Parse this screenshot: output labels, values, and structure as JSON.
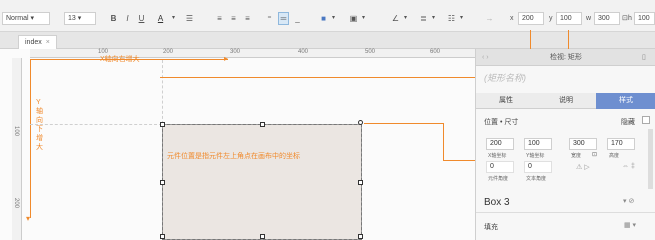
{
  "toolbar": {
    "style_value": "Normal",
    "font_size": "13",
    "bold_label": "B",
    "italic_label": "I",
    "underline_label": "U",
    "text_color_label": "A",
    "x_label": "x",
    "x_value": "200",
    "y_label": "y",
    "y_value": "100",
    "w_label": "w",
    "w_value": "300",
    "h_label": "h",
    "h_value": "100"
  },
  "tab": {
    "label": "index",
    "close": "×"
  },
  "rulers": {
    "h_ticks": [
      "100",
      "200",
      "300",
      "400",
      "500",
      "600"
    ],
    "v_ticks": [
      "100",
      "200"
    ]
  },
  "annotations": {
    "x_axis": "X轴向右增大",
    "y_axis": "Y轴向下增大",
    "coords_note": "元件位置是指元件左上角点在画布中的坐标"
  },
  "panel": {
    "header": "检视: 矩形",
    "title_placeholder": "(矩形名称)",
    "tabs": [
      "属性",
      "说明",
      "样式"
    ],
    "section_pos": "位置 • 尺寸",
    "hidden_label": "隐藏",
    "fields": {
      "x": "200",
      "y": "100",
      "w": "300",
      "h": "170",
      "rotation": "0",
      "text_rotation": "0"
    },
    "captions": {
      "x": "X轴坐标",
      "y": "Y轴坐标",
      "w": "宽度",
      "h": "高度",
      "rotation": "元件角度",
      "text_rotation": "文本角度"
    },
    "element_name": "Box 3",
    "fill_label": "填充"
  },
  "colors": {
    "accent": "#f08a2c",
    "tab_active": "#6e8fd0",
    "box_fill": "#ebe6e2"
  }
}
